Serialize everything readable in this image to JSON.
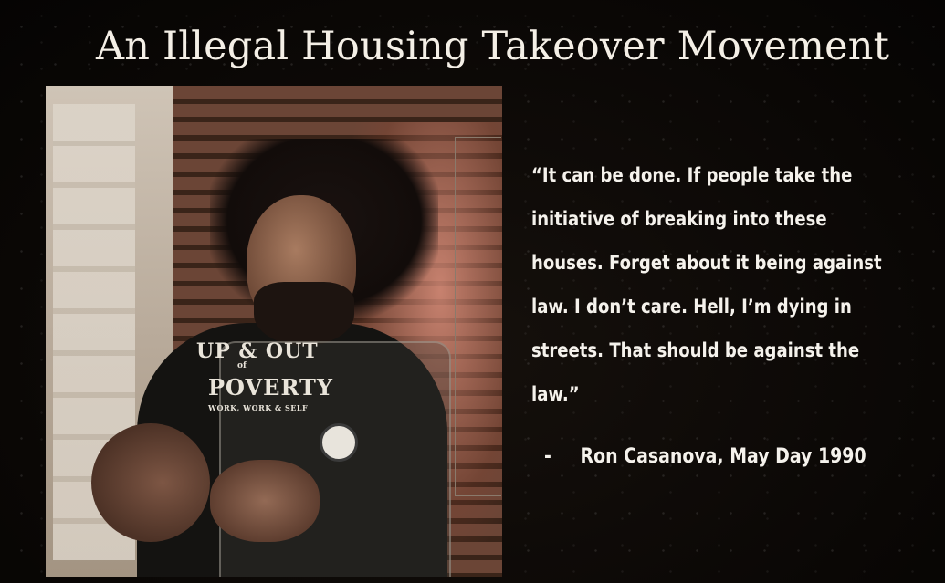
{
  "slide": {
    "title": "An Illegal Housing Takeover Movement",
    "photo": {
      "shirt_line_1": "UP & OUT",
      "shirt_line_2": "of",
      "shirt_line_3": "POVERTY",
      "shirt_line_4": "WORK, WORK & SELF"
    },
    "quote_lines": [
      "“It can be done.  If people take the",
      "initiative of breaking into these",
      "houses.  Forget about it being against",
      "law.  I don’t care.  Hell, I’m dying in",
      "streets.  That should be against the",
      "law.”"
    ],
    "attribution_dash": "-",
    "attribution": "Ron Casanova, May Day 1990"
  }
}
